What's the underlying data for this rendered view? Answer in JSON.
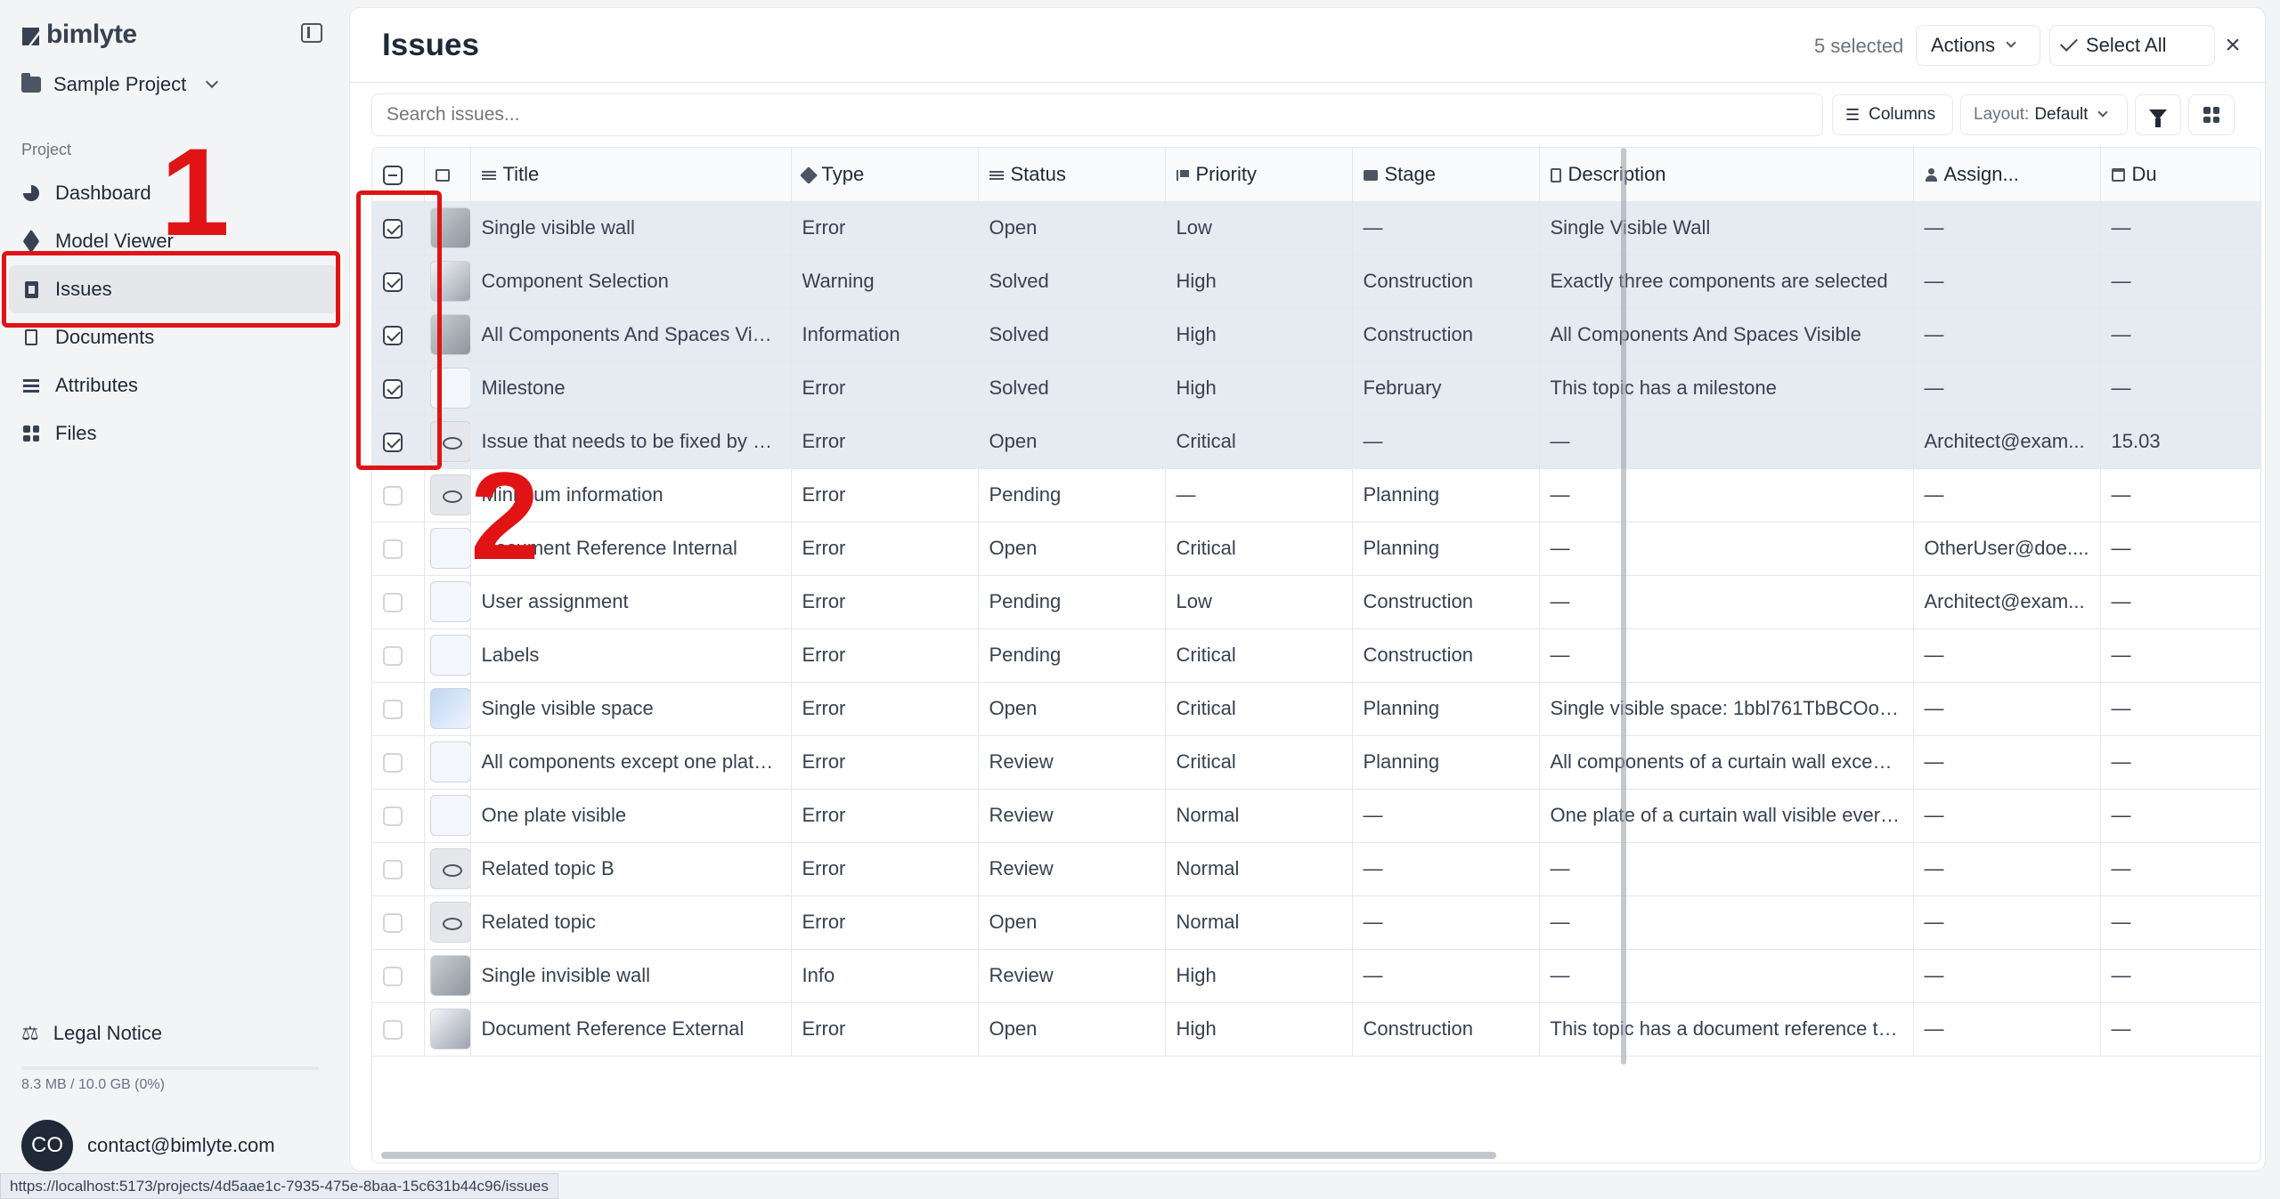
{
  "app": {
    "brand": "bimlyte",
    "project": "Sample Project"
  },
  "sidebar": {
    "section": "Project",
    "items": [
      {
        "label": "Dashboard",
        "icon": "pie-chart-icon"
      },
      {
        "label": "Model Viewer",
        "icon": "cube-icon"
      },
      {
        "label": "Issues",
        "icon": "clipboard-icon",
        "active": true
      },
      {
        "label": "Documents",
        "icon": "document-icon"
      },
      {
        "label": "Attributes",
        "icon": "sliders-icon"
      },
      {
        "label": "Files",
        "icon": "grid-icon"
      }
    ],
    "legal": "Legal Notice",
    "storage": "8.3 MB / 10.0 GB (0%)",
    "user_initials": "CO",
    "user_email": "contact@bimlyte.com"
  },
  "status_url": "https://localhost:5173/projects/4d5aae1c-7935-475e-8baa-15c631b44c96/issues",
  "header": {
    "title": "Issues",
    "selected_count": "5 selected",
    "actions_label": "Actions",
    "select_all_label": "Select All"
  },
  "toolbar": {
    "search_placeholder": "Search issues...",
    "columns_label": "Columns",
    "layout_prefix": "Layout:",
    "layout_value": "Default"
  },
  "table": {
    "headers": [
      "Title",
      "Type",
      "Status",
      "Priority",
      "Stage",
      "Description",
      "Assign...",
      "Du"
    ],
    "rows": [
      {
        "selected": true,
        "thumb": "grey",
        "title": "Single visible wall",
        "type": "Error",
        "status": "Open",
        "priority": "Low",
        "stage": "—",
        "description": "Single Visible Wall",
        "assignee": "—",
        "due": "—"
      },
      {
        "selected": true,
        "thumb": "img",
        "title": "Component Selection",
        "type": "Warning",
        "status": "Solved",
        "priority": "High",
        "stage": "Construction",
        "description": "Exactly three components are selected",
        "assignee": "—",
        "due": "—"
      },
      {
        "selected": true,
        "thumb": "grey",
        "title": "All Components And Spaces Visi...",
        "type": "Information",
        "status": "Solved",
        "priority": "High",
        "stage": "Construction",
        "description": "All Components And Spaces Visible",
        "assignee": "—",
        "due": "—"
      },
      {
        "selected": true,
        "thumb": "light",
        "title": "Milestone",
        "type": "Error",
        "status": "Solved",
        "priority": "High",
        "stage": "February",
        "description": "This topic has a milestone",
        "assignee": "—",
        "due": "—"
      },
      {
        "selected": true,
        "thumb": "hidden",
        "title": "Issue that needs to be fixed by a ...",
        "type": "Error",
        "status": "Open",
        "priority": "Critical",
        "stage": "—",
        "description": "—",
        "assignee": "Architect@exam...",
        "due": "15.03"
      },
      {
        "selected": false,
        "thumb": "hidden",
        "title": "Minimum information",
        "type": "Error",
        "status": "Pending",
        "priority": "—",
        "stage": "Planning",
        "description": "—",
        "assignee": "—",
        "due": "—"
      },
      {
        "selected": false,
        "thumb": "light",
        "title": "Document Reference Internal",
        "type": "Error",
        "status": "Open",
        "priority": "Critical",
        "stage": "Planning",
        "description": "—",
        "assignee": "OtherUser@doe....",
        "due": "—"
      },
      {
        "selected": false,
        "thumb": "light",
        "title": "User assignment",
        "type": "Error",
        "status": "Pending",
        "priority": "Low",
        "stage": "Construction",
        "description": "—",
        "assignee": "Architect@exam...",
        "due": "—"
      },
      {
        "selected": false,
        "thumb": "light",
        "title": "Labels",
        "type": "Error",
        "status": "Pending",
        "priority": "Critical",
        "stage": "Construction",
        "description": "—",
        "assignee": "—",
        "due": "—"
      },
      {
        "selected": false,
        "thumb": "blue",
        "title": "Single visible space",
        "type": "Error",
        "status": "Open",
        "priority": "Critical",
        "stage": "Planning",
        "description": "Single visible space: 1bbl761TbBCOola...",
        "assignee": "—",
        "due": "—"
      },
      {
        "selected": false,
        "thumb": "light",
        "title": "All components except one plate...",
        "type": "Error",
        "status": "Review",
        "priority": "Critical",
        "stage": "Planning",
        "description": "All components of a curtain wall except ...",
        "assignee": "—",
        "due": "—"
      },
      {
        "selected": false,
        "thumb": "light",
        "title": "One plate visible",
        "type": "Error",
        "status": "Review",
        "priority": "Normal",
        "stage": "—",
        "description": "One plate of a curtain wall visible everyt...",
        "assignee": "—",
        "due": "—"
      },
      {
        "selected": false,
        "thumb": "hidden",
        "title": "Related topic B",
        "type": "Error",
        "status": "Review",
        "priority": "Normal",
        "stage": "—",
        "description": "—",
        "assignee": "—",
        "due": "—"
      },
      {
        "selected": false,
        "thumb": "hidden",
        "title": "Related topic",
        "type": "Error",
        "status": "Open",
        "priority": "Normal",
        "stage": "—",
        "description": "—",
        "assignee": "—",
        "due": "—"
      },
      {
        "selected": false,
        "thumb": "grey",
        "title": "Single invisible wall",
        "type": "Info",
        "status": "Review",
        "priority": "High",
        "stage": "—",
        "description": "—",
        "assignee": "—",
        "due": "—"
      },
      {
        "selected": false,
        "thumb": "img",
        "title": "Document Reference External",
        "type": "Error",
        "status": "Open",
        "priority": "High",
        "stage": "Construction",
        "description": "This topic has a document reference to ...",
        "assignee": "—",
        "due": "—"
      }
    ]
  },
  "annotations": {
    "one": "1",
    "two": "2",
    "color": "#e01414"
  }
}
